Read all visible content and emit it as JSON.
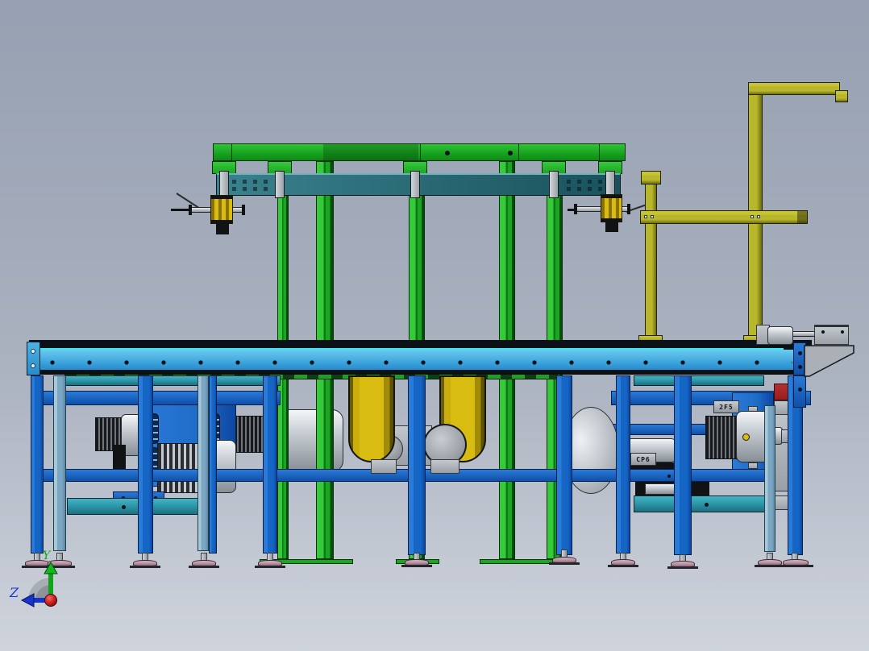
{
  "triad": {
    "y_label": "Y",
    "z_label": "Z"
  },
  "part_labels": {
    "left_gearbox": "CP6",
    "right_gearbox": "2F5"
  },
  "colors": {
    "bg_top": "#96a0b2",
    "bg_bottom": "#cfd4dc",
    "green_light": "#36c93b",
    "green_mid": "#1aa622",
    "green_dark": "#0c7a12",
    "table_blue_top": "#6accf0",
    "table_blue_bot": "#1e86cc",
    "table_edge": "#0b1116",
    "cyan_line": "#3ee6f0",
    "leg_blue": "#1565c4",
    "leg_blue_dark": "#0f4fa8",
    "leg_steel": "#7ba6c2",
    "frame_blue": "#1f6cc8",
    "teal_rail": "#2f9dae",
    "teal_beam_a": "#3a828e",
    "teal_beam_b": "#19525c",
    "olive_a": "#b8b62a",
    "olive_b": "#6e6d10",
    "belt_a": "#d8bc12",
    "belt_b": "#6b5d04",
    "gray_metal": "#9aa0a6",
    "silver_hi": "#f4f6f8",
    "silver_lo": "#878f96",
    "red_block": "#9b1c1c",
    "foot_pink": "#b78e9f",
    "triad_green": "#0fa41a",
    "triad_blue": "#1733cc",
    "triad_red": "#cc2020",
    "arc_gray": "#a6abb4"
  }
}
